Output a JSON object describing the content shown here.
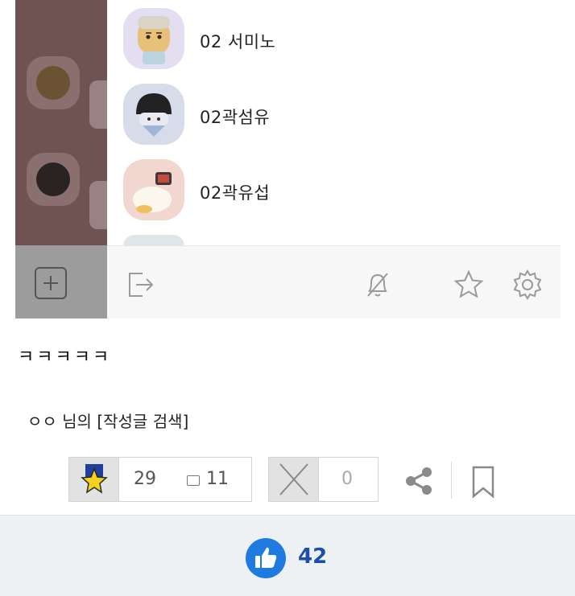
{
  "drawer": {
    "members": [
      {
        "name": "02 서미노",
        "avatar": "ryan-avatar"
      },
      {
        "name": "02곽섬유",
        "avatar": "helmet-character-avatar"
      },
      {
        "name": "02곽유섭",
        "avatar": "apeach-tv-avatar"
      }
    ]
  },
  "post": {
    "text": "ㅋㅋㅋㅋㅋ",
    "author": "ㅇㅇ 님의",
    "search_link": "[작성글 검색]"
  },
  "votes": {
    "up": "29",
    "sub": "11",
    "down": "0"
  },
  "like": {
    "count": "42",
    "color": "#1f7be0"
  },
  "colors": {
    "like_count": "#1c4fa8",
    "toolbar_bg": "#f7f7f7"
  }
}
